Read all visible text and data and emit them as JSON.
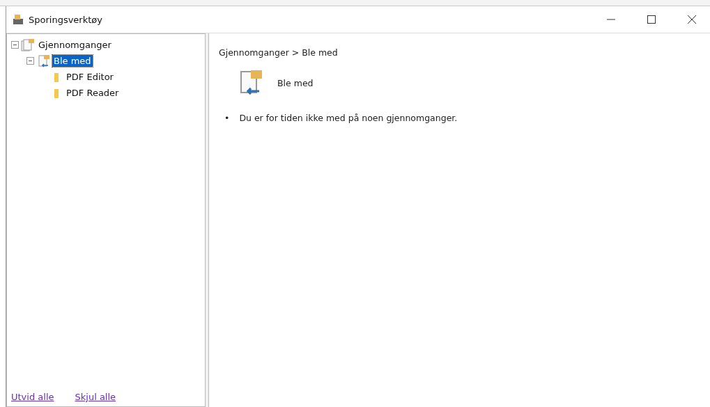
{
  "window": {
    "title": "Sporingsverktøy"
  },
  "tree": [
    {
      "label": "Gjennomganger",
      "kind": "reviews",
      "expanded": true,
      "selected": false,
      "children": [
        {
          "label": "Ble med",
          "kind": "joined",
          "expanded": true,
          "selected": true,
          "children": [
            {
              "label": "PDF Editor",
              "kind": "folder",
              "selected": false
            },
            {
              "label": "PDF Reader",
              "kind": "folder",
              "selected": false
            }
          ]
        }
      ]
    }
  ],
  "links": [
    "Utvid alle",
    "Skjul alle"
  ],
  "breadcrumb": "Gjennomganger > Ble med",
  "heading": "Ble med",
  "bullets": [
    {
      "marker": "•",
      "text": "Du er for tiden ikke med på noen gjennomganger."
    }
  ]
}
